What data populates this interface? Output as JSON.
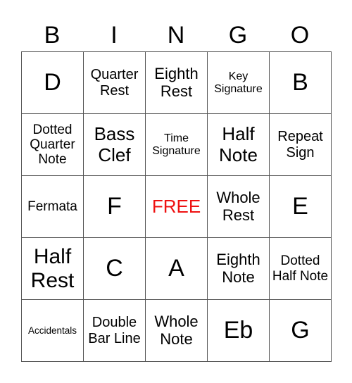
{
  "header": [
    "B",
    "I",
    "N",
    "G",
    "O"
  ],
  "free_color": "#ee1111",
  "rows": [
    [
      "D",
      "Quarter Rest",
      "Eighth Rest",
      "Key Signature",
      "B"
    ],
    [
      "Dotted Quarter Note",
      "Bass Clef",
      "Time Signature",
      "Half Note",
      "Repeat Sign"
    ],
    [
      "Fermata",
      "F",
      "FREE",
      "Whole Rest",
      "E"
    ],
    [
      "Half Rest",
      "C",
      "A",
      "Eighth Note",
      "Dotted Half Note"
    ],
    [
      "Accidentals",
      "Double Bar Line",
      "Whole Note",
      "Eb",
      "G"
    ]
  ]
}
